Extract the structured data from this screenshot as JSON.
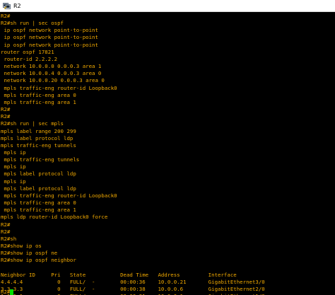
{
  "window": {
    "title": "R2",
    "icon": "putty-terminal-icon"
  },
  "terminal": {
    "text_color": "#f0a800",
    "background": "#000000",
    "cursor_color": "#00e000",
    "lines": [
      "R2#",
      "R2#sh run | sec ospf",
      " ip ospf network point-to-point",
      " ip ospf network point-to-point",
      " ip ospf network point-to-point",
      "router ospf 17821",
      " router-id 2.2.2.2",
      " network 10.0.0.0 0.0.0.3 area 1",
      " network 10.0.0.4 0.0.0.3 area 0",
      " network 10.0.0.20 0.0.0.3 area 0",
      " mpls traffic-eng router-id Loopback0",
      " mpls traffic-eng area 0",
      " mpls traffic-eng area 1",
      "R2#",
      "R2#",
      "R2#sh run | sec mpls",
      "mpls label range 200 299",
      "mpls label protocol ldp",
      "mpls traffic-eng tunnels",
      " mpls ip",
      " mpls traffic-eng tunnels",
      " mpls ip",
      " mpls label protocol ldp",
      " mpls ip",
      " mpls label protocol ldp",
      " mpls traffic-eng router-id Loopback0",
      " mpls traffic-eng area 0",
      " mpls traffic-eng area 1",
      "mpls ldp router-id Loopback0 force",
      "R2#",
      "R2#",
      "R2#sh",
      "R2#show ip os",
      "R2#show ip ospf ne",
      "R2#show ip ospf neighbor",
      "",
      "Neighbor ID     Pri   State           Dead Time   Address         Interface",
      "4.4.4.4           0   FULL/  -        00:00:36    10.0.0.21       GigabitEthernet3/0",
      "3.3.3.3           0   FULL/  -        00:00:38    10.0.0.6        GigabitEthernet2/0",
      "1.1.1.1           0   FULL/  -        00:00:31    10.0.0.1        GigabitEthernet1/0"
    ],
    "prompt": "R2#"
  }
}
